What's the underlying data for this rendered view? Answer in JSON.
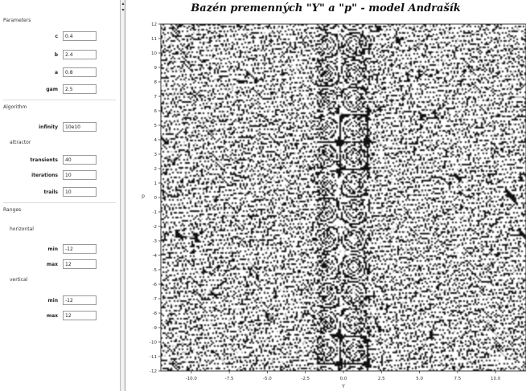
{
  "parameters": {
    "section_label": "Parameters",
    "fields": [
      {
        "label": "c",
        "value": "0.4"
      },
      {
        "label": "b",
        "value": "2.4"
      },
      {
        "label": "a",
        "value": "0.8"
      },
      {
        "label": "gam",
        "value": "2.5"
      }
    ]
  },
  "algorithm": {
    "section_label": "Algorithm",
    "infinity": {
      "label": "infinity",
      "value": "10e10"
    },
    "attractor": {
      "label": "attractor",
      "fields": [
        {
          "label": "transients",
          "value": "40"
        },
        {
          "label": "iterations",
          "value": "10"
        },
        {
          "label": "trails",
          "value": "10"
        }
      ]
    }
  },
  "ranges": {
    "section_label": "Ranges",
    "horizontal": {
      "label": "horizontal",
      "min": {
        "label": "min",
        "value": "-12"
      },
      "max": {
        "label": "max",
        "value": "12"
      }
    },
    "vertical": {
      "label": "vertical",
      "min": {
        "label": "min",
        "value": "-12"
      },
      "max": {
        "label": "max",
        "value": "12"
      }
    }
  },
  "splitter": {
    "arrow_up": "▴",
    "arrow_down": "▾"
  },
  "chart_data": {
    "type": "heatmap",
    "title": "Bazén premenných \"Y\" a \"p\" - model Andrašík",
    "xlabel": "Y",
    "ylabel": "p",
    "xlim": [
      -12,
      12
    ],
    "ylim": [
      -12,
      12
    ],
    "x_ticks": [
      "-10.0",
      "-7.5",
      "-5.0",
      "-2.5",
      "0.0",
      "2.5",
      "5.0",
      "7.5",
      "10.0"
    ],
    "y_ticks": [
      "12",
      "11",
      "10",
      "9",
      "8",
      "7",
      "6",
      "5",
      "4",
      "3",
      "2",
      "1",
      "0",
      "-1",
      "-2",
      "-3",
      "-4",
      "-5",
      "-6",
      "-7",
      "-8",
      "-9",
      "-10",
      "-11",
      "-12"
    ],
    "colors": {
      "dark": "#111111",
      "light": "#ffffff",
      "gray": "#b5b5b5"
    }
  }
}
